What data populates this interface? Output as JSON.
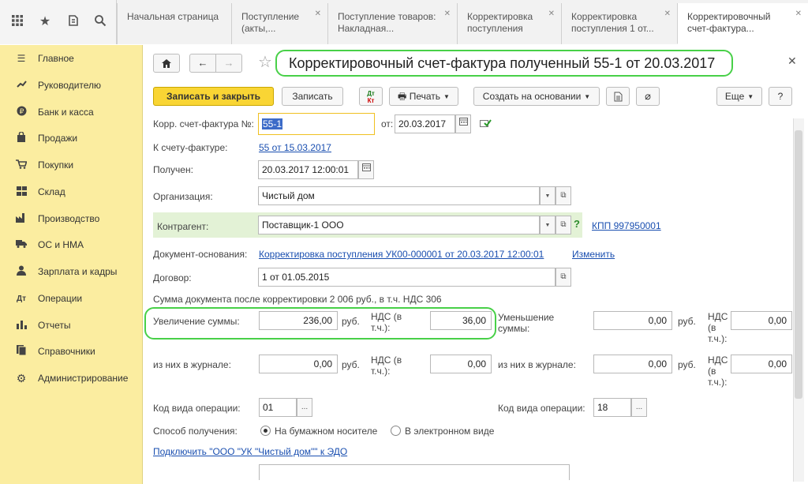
{
  "topbar": {
    "icons": [
      "apps-grid-icon",
      "star-icon",
      "history-icon",
      "search-icon"
    ],
    "tabs": [
      {
        "label": "Начальная страница",
        "closable": false,
        "active": false
      },
      {
        "label": "Поступление (акты,...",
        "closable": true,
        "active": false
      },
      {
        "label": "Поступление товаров: Накладная...",
        "closable": true,
        "active": false
      },
      {
        "label": "Корректировка поступления",
        "closable": true,
        "active": false
      },
      {
        "label": "Корректировка поступления 1 от...",
        "closable": true,
        "active": false
      },
      {
        "label": "Корректировочный счет-фактура...",
        "closable": true,
        "active": true
      }
    ]
  },
  "sidebar": {
    "items": [
      {
        "label": "Главное",
        "icon": "menu-lines-icon"
      },
      {
        "label": "Руководителю",
        "icon": "trend-icon"
      },
      {
        "label": "Банк и касса",
        "icon": "ruble-icon"
      },
      {
        "label": "Продажи",
        "icon": "bag-icon"
      },
      {
        "label": "Покупки",
        "icon": "cart-icon"
      },
      {
        "label": "Склад",
        "icon": "warehouse-icon"
      },
      {
        "label": "Производство",
        "icon": "factory-icon"
      },
      {
        "label": "ОС и НМА",
        "icon": "truck-icon"
      },
      {
        "label": "Зарплата и кадры",
        "icon": "person-icon"
      },
      {
        "label": "Операции",
        "icon": "operations-icon"
      },
      {
        "label": "Отчеты",
        "icon": "bar-chart-icon"
      },
      {
        "label": "Справочники",
        "icon": "book-icon"
      },
      {
        "label": "Администрирование",
        "icon": "gear-icon"
      }
    ]
  },
  "form": {
    "title": "Корректировочный счет-фактура полученный 55-1 от 20.03.2017",
    "toolbar": {
      "save_close": "Записать и закрыть",
      "save": "Записать",
      "print": "Печать",
      "create_based": "Создать на основании",
      "more": "Еще",
      "help": "?"
    },
    "fields": {
      "corr_invoice_label": "Корр. счет-фактура №:",
      "corr_invoice_no": "55-1",
      "from_label": "от:",
      "from_date": "20.03.2017",
      "to_invoice_label": "К счету-фактуре:",
      "to_invoice_link": "55 от 15.03.2017",
      "received_label": "Получен:",
      "received_value": "20.03.2017 12:00:01",
      "org_label": "Организация:",
      "org_value": "Чистый дом",
      "contragent_label": "Контрагент:",
      "contragent_value": "Поставщик-1 ООО",
      "kpp_link": "КПП 997950001",
      "base_doc_label": "Документ-основания:",
      "base_doc_link": "Корректировка поступления УК00-000001 от 20.03.2017 12:00:01",
      "change_link": "Изменить",
      "contract_label": "Договор:",
      "contract_value": "1 от 01.05.2015",
      "summary_text": "Сумма документа после корректировки 2 006 руб., в т.ч. НДС 306",
      "increase_label": "Увеличение суммы:",
      "increase_value": "236,00",
      "rub": "руб.",
      "nds_label": "НДС (в т.ч.):",
      "increase_nds": "36,00",
      "decrease_label": "Уменьшение суммы:",
      "decrease_value": "0,00",
      "decrease_nds": "0,00",
      "journal_label": "из них в журнале:",
      "journal_inc_value": "0,00",
      "journal_inc_nds": "0,00",
      "journal_dec_value": "0,00",
      "journal_dec_nds": "0,00",
      "op_code_label": "Код вида операции:",
      "op_code_left": "01",
      "op_code_right": "18",
      "receive_method_label": "Способ получения:",
      "paper_option": "На бумажном носителе",
      "electronic_option": "В электронном виде",
      "edo_link": "Подключить \"ООО \"УК \"Чистый дом\"\" к ЭДО"
    }
  }
}
